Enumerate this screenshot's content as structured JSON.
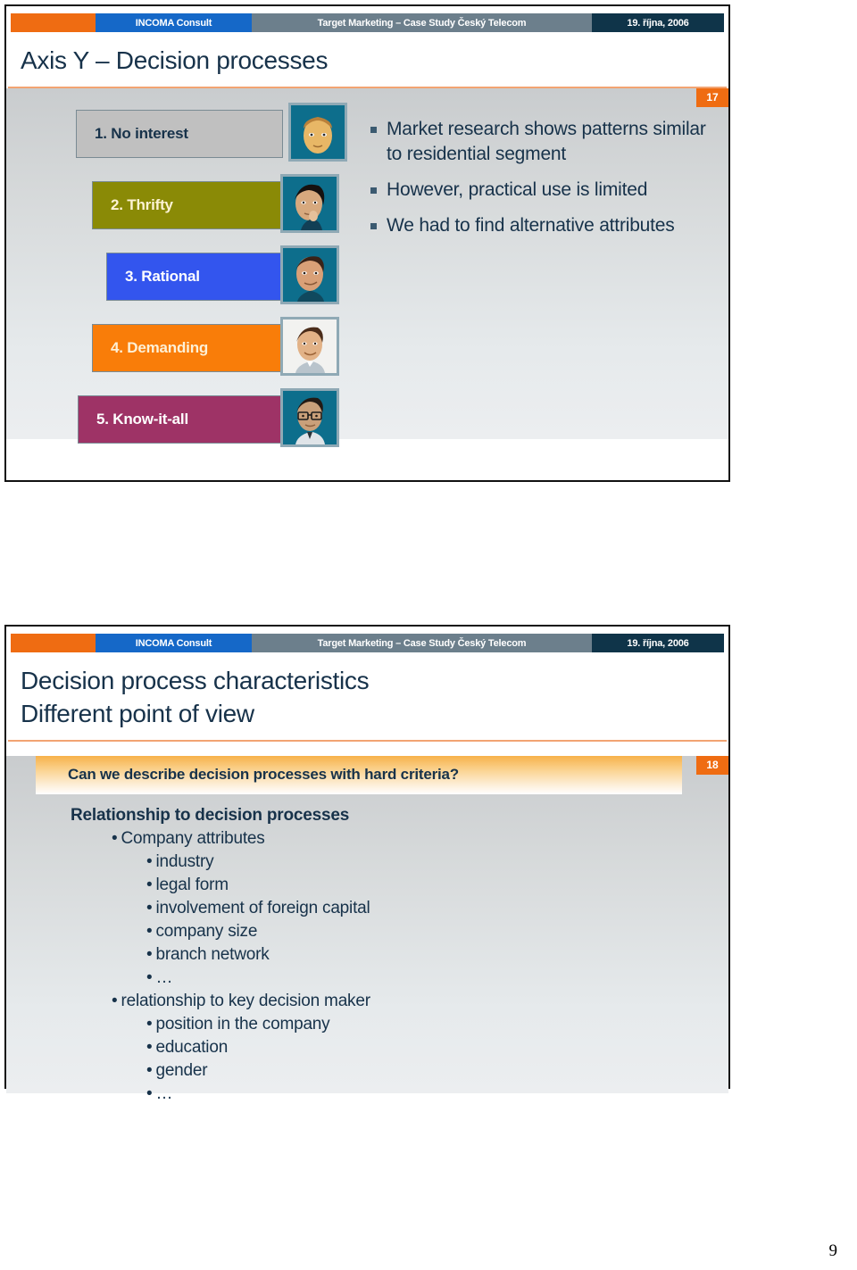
{
  "page": {
    "page_number": "9"
  },
  "header": {
    "company": "INCOMA Consult",
    "project": "Target Marketing – Case Study Český Telecom",
    "date": "19. října, 2006"
  },
  "slide17": {
    "badge": "17",
    "title": "Axis Y – Decision processes",
    "personas": [
      {
        "label": "1. No interest",
        "box_color": "#c0c0c0",
        "text_color": "#17324a",
        "avatar": "persona-face-1-icon",
        "thumb_bg": "#0d6e8c",
        "skin": "#e8b766",
        "hair": "#b9803a",
        "shirt": "#0d6e8c"
      },
      {
        "label": "2. Thrifty",
        "box_color": "#8a8a06",
        "text_color": "#fdf3d4",
        "avatar": "persona-face-2-icon",
        "thumb_bg": "#0d6e8c",
        "skin": "#d7a97e",
        "hair": "#16110f",
        "shirt": "#123f55"
      },
      {
        "label": "3. Rational",
        "box_color": "#3355ee",
        "text_color": "#ffffff",
        "avatar": "persona-face-3-icon",
        "thumb_bg": "#0d6e8c",
        "skin": "#d9a077",
        "hair": "#3a2318",
        "shirt": "#10495e"
      },
      {
        "label": "4. Demanding",
        "box_color": "#f97d09",
        "text_color": "#fdf0d6",
        "avatar": "persona-face-4-icon",
        "thumb_bg": "#f2f2f0",
        "skin": "#e2b287",
        "hair": "#4a2c1a",
        "shirt": "#b9c4cc"
      },
      {
        "label": "5. Know-it-all",
        "box_color": "#9e3366",
        "text_color": "#ffffff",
        "avatar": "persona-face-5-icon",
        "thumb_bg": "#0d6e8c",
        "skin": "#c9a07a",
        "hair": "#231a14",
        "shirt": "#dfe4e8"
      }
    ],
    "bullets": [
      "Market research shows patterns similar to residential segment",
      "However, practical use is limited",
      "We had to find alternative attributes"
    ]
  },
  "slide18": {
    "badge": "18",
    "title_line1": "Decision process characteristics",
    "title_line2": "Different point of view",
    "question": "Can we describe decision processes with hard criteria?",
    "outline": [
      {
        "level": 0,
        "text": "Relationship to decision processes",
        "bullet": ""
      },
      {
        "level": 1,
        "text": "Company attributes",
        "bullet": "•"
      },
      {
        "level": 2,
        "text": "industry",
        "bullet": "•"
      },
      {
        "level": 2,
        "text": "legal form",
        "bullet": "•"
      },
      {
        "level": 2,
        "text": "involvement of foreign capital",
        "bullet": "•"
      },
      {
        "level": 2,
        "text": "company size",
        "bullet": "•"
      },
      {
        "level": 2,
        "text": "branch network",
        "bullet": "•"
      },
      {
        "level": 2,
        "text": "…",
        "bullet": "•"
      },
      {
        "level": 1,
        "text": "relationship to key decision maker",
        "bullet": "•"
      },
      {
        "level": 2,
        "text": "position in the company",
        "bullet": "•"
      },
      {
        "level": 2,
        "text": "education",
        "bullet": "•"
      },
      {
        "level": 2,
        "text": "gender",
        "bullet": "•"
      },
      {
        "level": 2,
        "text": "…",
        "bullet": "•"
      }
    ]
  },
  "colors": {
    "brand_orange": "#ef6c12",
    "brand_blue": "#1568c8",
    "brand_gray": "#6c7f8c",
    "brand_navy": "#0f3449",
    "title_text": "#17324a",
    "banner_orange": "#f7b24a"
  }
}
